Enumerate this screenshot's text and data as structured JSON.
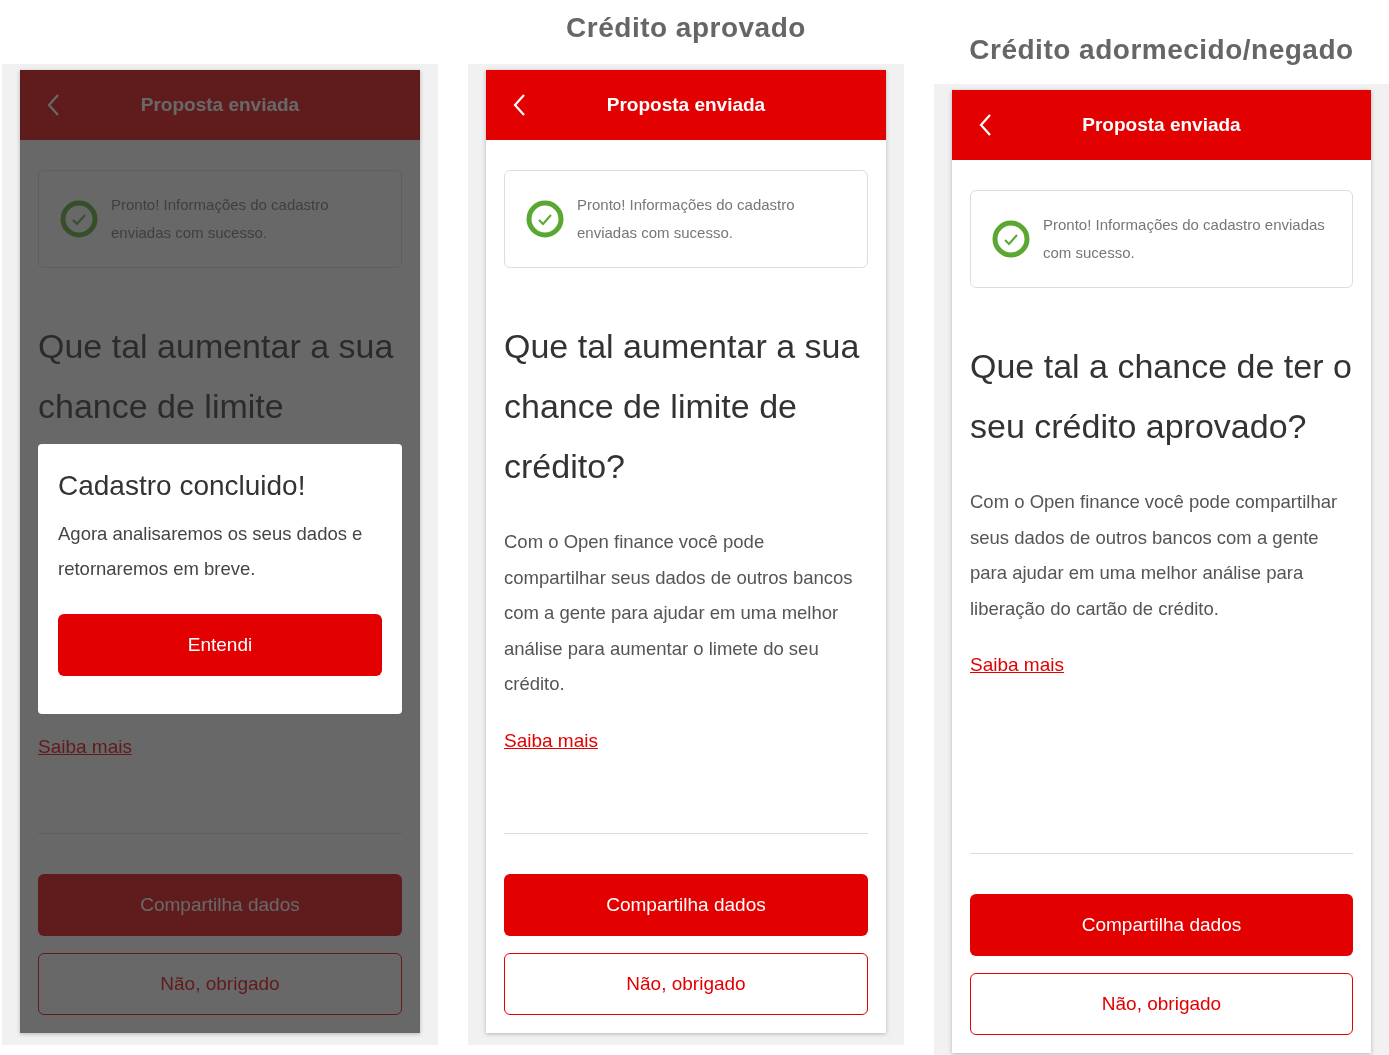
{
  "screens": [
    {
      "header": {
        "title": "Proposta enviada"
      },
      "notice": {
        "text": "Pronto! Informações do cadastro enviadas com sucesso."
      },
      "heading": "Que tal aumentar a sua chance de limite",
      "link": "Saiba mais",
      "buttons": [
        {
          "label": "Compartilha dados",
          "kind": "primary"
        },
        {
          "label": "Não, obrigado",
          "kind": "secondary"
        }
      ],
      "dialog": {
        "title": "Cadastro concluido!",
        "text": "Agora analisaremos os seus dados e retornaremos em breve.",
        "button": "Entendi"
      }
    },
    {
      "caption": "Crédito aprovado",
      "header": {
        "title": "Proposta enviada"
      },
      "notice": {
        "text": "Pronto! Informações do cadastro enviadas com sucesso."
      },
      "heading": "Que tal aumentar a sua chance de limite de crédito?",
      "body": "Com o Open finance você pode compartilhar seus dados de outros bancos com a gente para ajudar em uma melhor análise para aumentar o limete do seu crédito.",
      "link": "Saiba mais",
      "buttons": [
        {
          "label": "Compartilha dados",
          "kind": "primary"
        },
        {
          "label": "Não, obrigado",
          "kind": "secondary"
        }
      ]
    },
    {
      "caption": "Crédito adormecido/negado",
      "header": {
        "title": "Proposta enviada"
      },
      "notice": {
        "text": "Pronto! Informações do cadastro enviadas com sucesso."
      },
      "heading": "Que tal a chance de ter o seu crédito aprovado?",
      "body": "Com o Open finance você pode compartilhar seus dados de outros bancos com a gente para ajudar em uma melhor análise para liberação do cartão de crédito.",
      "link": "Saiba mais",
      "buttons": [
        {
          "label": "Compartilha dados",
          "kind": "primary"
        },
        {
          "label": "Não, obrigado",
          "kind": "secondary"
        }
      ]
    }
  ]
}
